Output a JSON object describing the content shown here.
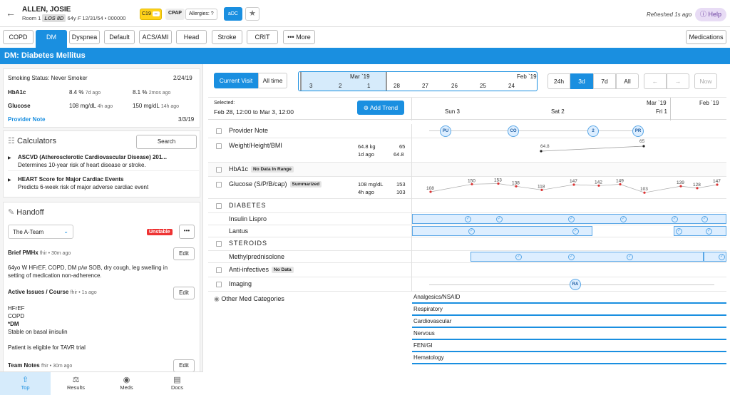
{
  "patient": {
    "name": "ALLEN, JOSIE",
    "room": "Room 1",
    "los": "LOS 8D",
    "age": "64y",
    "sex": "F",
    "dob": "12/31/54",
    "mrn": "• 000000"
  },
  "chips": {
    "c19": "C19",
    "c19_dash": "–",
    "cpap": "CPAP",
    "allergies": "Allergies: ?",
    "adc": "aDC"
  },
  "header": {
    "refreshed": "Refreshed 1s ago",
    "help": "Help"
  },
  "tabs": [
    "COPD",
    "DM",
    "Dyspnea",
    "Default",
    "ACS/AMI",
    "Head",
    "Stroke",
    "CRIT",
    "More"
  ],
  "medications_btn": "Medications",
  "section_title": "DM: Diabetes Mellitus",
  "summary": {
    "smoking": "Smoking Status: Never Smoker",
    "smoking_date": "2/24/19",
    "hba1c_label": "HbA1c",
    "hba1c_v1": "8.4 %",
    "hba1c_t1": "7d ago",
    "hba1c_v2": "8.1 %",
    "hba1c_t2": "2mos ago",
    "glucose_label": "Glucose",
    "glucose_v1": "108 mg/dL",
    "glucose_t1": "4h ago",
    "glucose_v2": "150 mg/dL",
    "glucose_t2": "14h ago",
    "provider_note": "Provider Note",
    "provider_note_date": "3/3/19"
  },
  "calculators": {
    "title": "Calculators",
    "search": "Search",
    "items": [
      {
        "title": "ASCVD (Atherosclerotic Cardiovascular Disease) 201...",
        "desc": "Determines 10-year risk of heart disease or stroke."
      },
      {
        "title": "HEART Score for Major Cardiac Events",
        "desc": "Predicts 6-week risk of major adverse cardiac event"
      }
    ]
  },
  "handoff": {
    "title": "Handoff",
    "team": "The A-Team",
    "status": "Unstable",
    "brief_label": "Brief PMHx",
    "brief_meta": "fhir • 30m ago",
    "brief_text_1": "64yo W HFrEF, COPD, DM p/w SOB, dry cough, leg swelling in",
    "brief_text_2": "setting of medication non-adherence.",
    "active_label": "Active Issues / Course",
    "active_meta": "fhir • 1s ago",
    "active_lines": [
      "HFrEF",
      "COPD",
      "*DM",
      "Stable on basal iinisulin",
      "",
      "Patient is eligible for TAVR trial"
    ],
    "team_label": "Team Notes",
    "team_meta": "fhir • 30m ago",
    "edit": "Edit"
  },
  "bottom_nav": [
    "Top",
    "Results",
    "Meds",
    "Docs"
  ],
  "timeline": {
    "current_visit": "Current Visit",
    "all_time": "All time",
    "mini_month_left": "Mar `19",
    "mini_month_right": "Feb `19",
    "mini_days": [
      "3",
      "2",
      "1",
      "28",
      "27",
      "26",
      "25",
      "24"
    ],
    "ranges": [
      "24h",
      "3d",
      "7d",
      "All"
    ],
    "now": "Now",
    "selected_label": "Selected:",
    "selected_range": "Feb 28, 12:00 to Mar 3, 12:00",
    "add_trend": "Add Trend",
    "axis_labels": [
      "Sun 3",
      "Sat 2",
      "Fri 1"
    ],
    "axis_month_1": "Mar `19",
    "axis_month_2": "Feb `19"
  },
  "rows": {
    "provider_note": "Provider Note",
    "provider_note_circles": [
      "PU",
      "CO",
      "2",
      "PR"
    ],
    "weight": "Weight/Height/BMI",
    "weight_v1": "64.8 kg",
    "weight_v1b": "65",
    "weight_t1": "1d ago",
    "weight_v2": "64.8",
    "weight_pt_a": "64.8",
    "weight_pt_b": "65",
    "hba1c": "HbA1c",
    "hba1c_badge": "No Data In Range",
    "glucose": "Glucose (S/P/B/cap)",
    "glucose_badge": "Summarized",
    "glucose_v1": "108 mg/dL",
    "glucose_v1b": "153",
    "glucose_t1": "4h ago",
    "glucose_v2": "103",
    "glucose_points": [
      "108",
      "150",
      "153",
      "138",
      "118",
      "147",
      "142",
      "149",
      "103",
      "139",
      "128",
      "147"
    ],
    "diabetes": "DIABETES",
    "insulin": "Insulin Lispro",
    "lantus": "Lantus",
    "steroids": "STEROIDS",
    "methyl": "Methylprednisolone",
    "antiinf": "Anti-infectives",
    "antiinf_badge": "No Data",
    "imaging": "Imaging",
    "imaging_circle": "RA",
    "other_med": "Other Med Categories",
    "categories": [
      "Analgesics/NSAID",
      "Respiratory",
      "Cardiovascular",
      "Nervous",
      "FEN/GI",
      "Hematology"
    ]
  }
}
